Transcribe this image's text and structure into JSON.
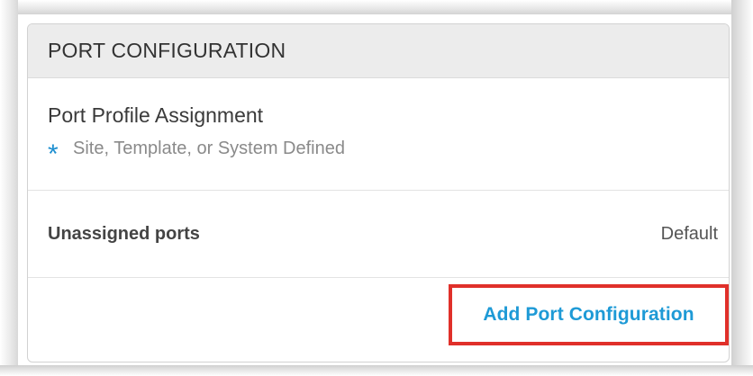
{
  "panel": {
    "title": "PORT CONFIGURATION"
  },
  "profile_assignment": {
    "title": "Port Profile Assignment",
    "marker": "*",
    "subtitle": "Site, Template, or System Defined"
  },
  "unassigned": {
    "label": "Unassigned ports",
    "value": "Default"
  },
  "actions": {
    "add_label": "Add Port Configuration"
  },
  "colors": {
    "accent": "#1e9ad6",
    "highlight_border": "#e0302a",
    "header_bg": "#ececec"
  },
  "icons": {
    "required": "asterisk-icon"
  }
}
